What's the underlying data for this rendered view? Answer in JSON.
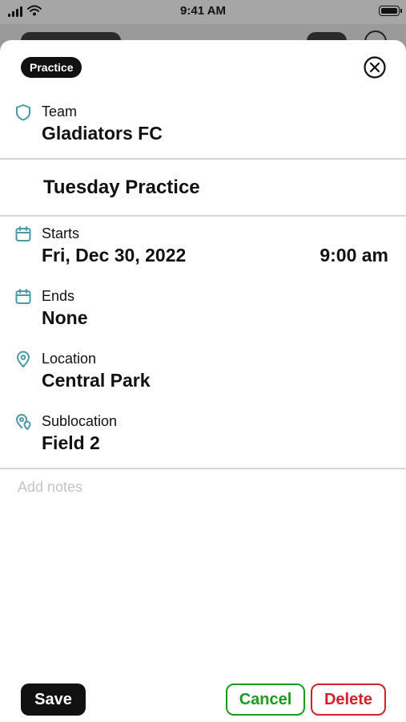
{
  "status_bar": {
    "time": "9:41 AM"
  },
  "badge": "Practice",
  "team": {
    "label": "Team",
    "value": "Gladiators FC"
  },
  "event_title": "Tuesday Practice",
  "starts": {
    "label": "Starts",
    "date": "Fri, Dec 30, 2022",
    "time": "9:00 am"
  },
  "ends": {
    "label": "Ends",
    "value": "None"
  },
  "location": {
    "label": "Location",
    "value": "Central Park"
  },
  "sublocation": {
    "label": "Sublocation",
    "value": "Field 2"
  },
  "notes": {
    "placeholder": "Add notes"
  },
  "buttons": {
    "save": "Save",
    "cancel": "Cancel",
    "delete": "Delete"
  },
  "colors": {
    "icon_teal": "#4a98a8",
    "cancel_green": "#1a9a1f",
    "delete_red": "#d3202a"
  },
  "icons": [
    "shield-icon",
    "calendar-icon",
    "location-pin-icon",
    "sublocation-pin-icon",
    "close-circle-icon"
  ]
}
